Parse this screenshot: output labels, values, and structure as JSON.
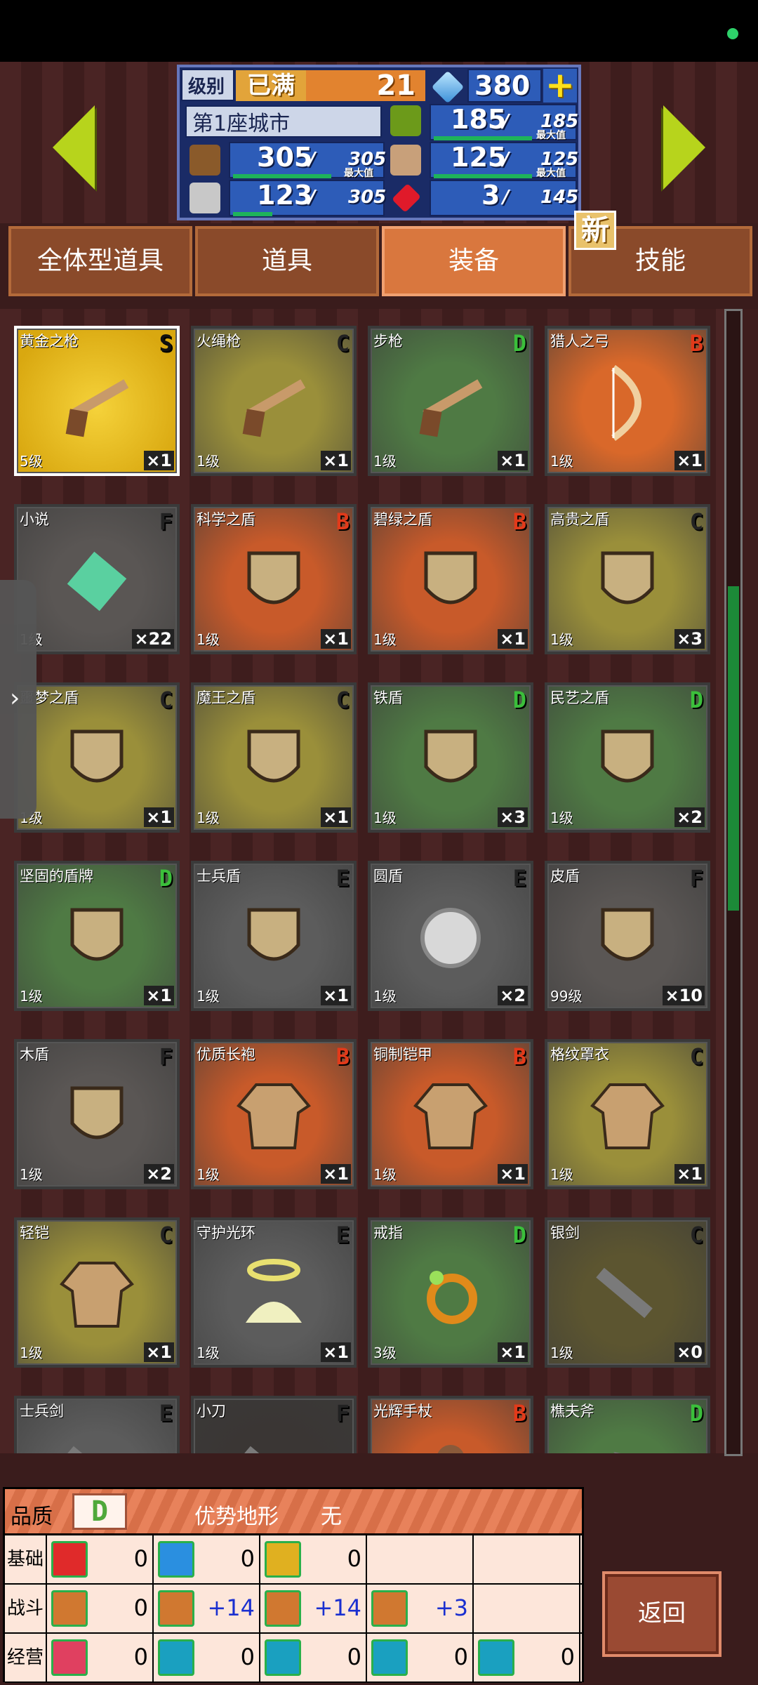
{
  "header": {
    "level_label": "级别",
    "level_full": "已满",
    "level_value": "21",
    "gems": "380",
    "city": "第1座城市",
    "wood": "305",
    "wood_max": "305",
    "food": "185",
    "food_max": "185",
    "ore": "123",
    "ore_max": "305",
    "people": "125",
    "people_max": "125",
    "ruby": "3",
    "ruby_max": "145",
    "max_label": "最大值",
    "wood_fill": 1.0,
    "food_fill": 1.0,
    "ore_fill": 0.4,
    "people_fill": 1.0
  },
  "tabs": [
    {
      "label": "全体型道具"
    },
    {
      "label": "道具"
    },
    {
      "label": "装备",
      "active": true
    },
    {
      "label": "技能"
    }
  ],
  "new_badge": "新",
  "grade_colors": {
    "S": "#111",
    "A": "#d33",
    "B": "#e23a1a",
    "C": "#222",
    "D": "#3bbf3b",
    "E": "#222",
    "F": "#222"
  },
  "items": [
    {
      "name": "黄金之枪",
      "grade": "S",
      "level": "5级",
      "qty": "×1",
      "bg": "#e0b61a",
      "icon": "gun-icon",
      "selected": true
    },
    {
      "name": "火绳枪",
      "grade": "C",
      "level": "1级",
      "qty": "×1",
      "bg": "#9a8f3a",
      "icon": "musket-icon"
    },
    {
      "name": "步枪",
      "grade": "D",
      "level": "1级",
      "qty": "×1",
      "bg": "#4f7a44",
      "icon": "rifle-icon"
    },
    {
      "name": "猎人之弓",
      "grade": "B",
      "level": "1级",
      "qty": "×1",
      "bg": "#d9682a",
      "icon": "bow-icon"
    },
    {
      "name": "小说",
      "grade": "F",
      "level": "1级",
      "qty": "×22",
      "bg": "#5a5654",
      "icon": "book-icon"
    },
    {
      "name": "科学之盾",
      "grade": "B",
      "level": "1级",
      "qty": "×1",
      "bg": "#c85a2a",
      "icon": "shield-icon"
    },
    {
      "name": "碧绿之盾",
      "grade": "B",
      "level": "1级",
      "qty": "×1",
      "bg": "#c85a2a",
      "icon": "shield-icon"
    },
    {
      "name": "高贵之盾",
      "grade": "C",
      "level": "1级",
      "qty": "×3",
      "bg": "#9a8f3a",
      "icon": "shield-icon"
    },
    {
      "name": "噩梦之盾",
      "grade": "C",
      "level": "1级",
      "qty": "×1",
      "bg": "#9a8f3a",
      "icon": "shield-icon"
    },
    {
      "name": "魔王之盾",
      "grade": "C",
      "level": "1级",
      "qty": "×1",
      "bg": "#9a8f3a",
      "icon": "shield-icon"
    },
    {
      "name": "铁盾",
      "grade": "D",
      "level": "1级",
      "qty": "×3",
      "bg": "#4f7a44",
      "icon": "shield-icon"
    },
    {
      "name": "民艺之盾",
      "grade": "D",
      "level": "1级",
      "qty": "×2",
      "bg": "#4f7a44",
      "icon": "shield-icon"
    },
    {
      "name": "坚固的盾牌",
      "grade": "D",
      "level": "1级",
      "qty": "×1",
      "bg": "#4f7a44",
      "icon": "shield-icon"
    },
    {
      "name": "士兵盾",
      "grade": "E",
      "level": "1级",
      "qty": "×1",
      "bg": "#5c5c5c",
      "icon": "shield-icon"
    },
    {
      "name": "圆盾",
      "grade": "E",
      "level": "1级",
      "qty": "×2",
      "bg": "#5c5c5c",
      "icon": "round-shield-icon"
    },
    {
      "name": "皮盾",
      "grade": "F",
      "level": "99级",
      "qty": "×10",
      "bg": "#5a5654",
      "icon": "shield-icon"
    },
    {
      "name": "木盾",
      "grade": "F",
      "level": "1级",
      "qty": "×2",
      "bg": "#5a5654",
      "icon": "shield-icon"
    },
    {
      "name": "优质长袍",
      "grade": "B",
      "level": "1级",
      "qty": "×1",
      "bg": "#c85a2a",
      "icon": "robe-icon"
    },
    {
      "name": "铜制铠甲",
      "grade": "B",
      "level": "1级",
      "qty": "×1",
      "bg": "#c85a2a",
      "icon": "armor-icon"
    },
    {
      "name": "格纹罩衣",
      "grade": "C",
      "level": "1级",
      "qty": "×1",
      "bg": "#9a8f3a",
      "icon": "coat-icon"
    },
    {
      "name": "轻铠",
      "grade": "C",
      "level": "1级",
      "qty": "×1",
      "bg": "#9a8f3a",
      "icon": "armor-icon"
    },
    {
      "name": "守护光环",
      "grade": "E",
      "level": "1级",
      "qty": "×1",
      "bg": "#5c5c5c",
      "icon": "halo-icon"
    },
    {
      "name": "戒指",
      "grade": "D",
      "level": "3级",
      "qty": "×1",
      "bg": "#4f7a44",
      "icon": "ring-icon"
    },
    {
      "name": "银剑",
      "grade": "C",
      "level": "1级",
      "qty": "×0",
      "bg": "#5c5530",
      "icon": "sword-icon"
    },
    {
      "name": "士兵剑",
      "grade": "E",
      "level": "",
      "qty": "",
      "bg": "#5c5c5c",
      "icon": "sword-icon"
    },
    {
      "name": "小刀",
      "grade": "F",
      "level": "",
      "qty": "",
      "bg": "#3a3634",
      "icon": "knife-icon"
    },
    {
      "name": "光辉手杖",
      "grade": "B",
      "level": "",
      "qty": "",
      "bg": "#c85a2a",
      "icon": "staff-icon"
    },
    {
      "name": "樵夫斧",
      "grade": "D",
      "level": "",
      "qty": "",
      "bg": "#4f7a44",
      "icon": "axe-icon"
    }
  ],
  "side_tab": "›",
  "bottom": {
    "quality_label": "品质",
    "quality_value": "D",
    "terrain_label": "优势地形",
    "terrain_value": "无",
    "rows": [
      {
        "label": "基础",
        "cells": [
          {
            "icon": "heart-icon",
            "color": "#e02a2a",
            "value": "0"
          },
          {
            "icon": "potion-icon",
            "color": "#2a8fe0",
            "value": "0"
          },
          {
            "icon": "strength-icon",
            "color": "#e0b020",
            "value": "0"
          },
          {
            "icon": "",
            "color": "",
            "value": ""
          },
          {
            "icon": "",
            "color": "",
            "value": ""
          }
        ]
      },
      {
        "label": "战斗",
        "cells": [
          {
            "icon": "sword-stat-icon",
            "color": "#d07830",
            "value": "0"
          },
          {
            "icon": "shield-stat-icon",
            "color": "#d07830",
            "value": "+14"
          },
          {
            "icon": "arrows-stat-icon",
            "color": "#d07830",
            "value": "+14"
          },
          {
            "icon": "star-stat-icon",
            "color": "#d07830",
            "value": "+3"
          },
          {
            "icon": "",
            "color": "",
            "value": ""
          }
        ]
      },
      {
        "label": "经营",
        "cells": [
          {
            "icon": "scroll-icon",
            "color": "#e04060",
            "value": "0"
          },
          {
            "icon": "hammer-icon",
            "color": "#1aa0c0",
            "value": "0"
          },
          {
            "icon": "shovel-icon",
            "color": "#1aa0c0",
            "value": "0"
          },
          {
            "icon": "chest-icon",
            "color": "#1aa0c0",
            "value": "0"
          },
          {
            "icon": "tool-icon",
            "color": "#1aa0c0",
            "value": "0"
          }
        ]
      }
    ],
    "back_label": "返回"
  }
}
